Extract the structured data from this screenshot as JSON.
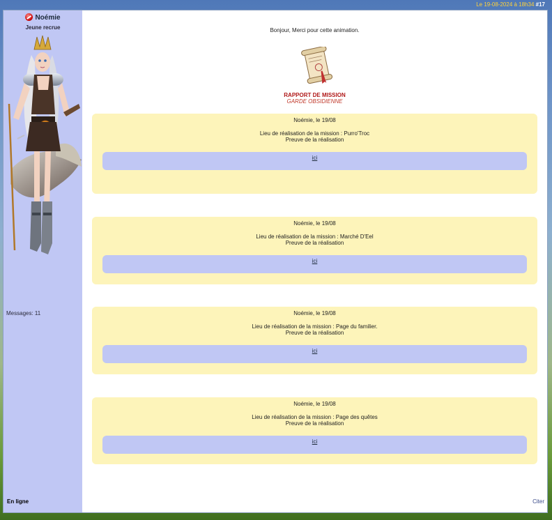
{
  "header": {
    "date": "Le 19-08-2024 à 18h34",
    "post_number": "#17"
  },
  "user": {
    "name": "Noémie",
    "rank": "Jeune recrue",
    "messages": "Messages: 11",
    "status": "En ligne",
    "status_color": "#c40000"
  },
  "post": {
    "greeting": "Bonjour, Merci pour cette animation.",
    "report_title": "RAPPORT DE MISSION",
    "report_subtitle": "GARDE OBSIDIENNE",
    "entries": [
      {
        "date": "Noémie, le 19/08",
        "place": "Lieu de réalisation de la mission : Purro'Troc",
        "proof": "Preuve de la  réalisation",
        "link": "ici"
      },
      {
        "date": "Noémie, le 19/08",
        "place": "Lieu de réalisation de la mission : Marché D'Eel",
        "proof": "Preuve de la  réalisation",
        "link": "ici"
      },
      {
        "date": "Noémie, le 19/08",
        "place": "Lieu de réalisation de la mission : Page du familier.",
        "proof": "Preuve de la réalisation",
        "link": "ici"
      },
      {
        "date": "Noémie, le 19/08",
        "place": "Lieu de réalisation de la mission : Page des quêtes",
        "proof": "Preuve de la réalisation",
        "link": "ici"
      }
    ],
    "quote_label": "Citer"
  },
  "colors": {
    "box": "#fdf4ba",
    "bar": "#c0c7f4",
    "sidebar": "#c0c7f4",
    "title_red": "#b01818"
  },
  "icons": {
    "status": "status-icon",
    "scroll": "scroll-icon",
    "avatar": "avatar-image"
  }
}
